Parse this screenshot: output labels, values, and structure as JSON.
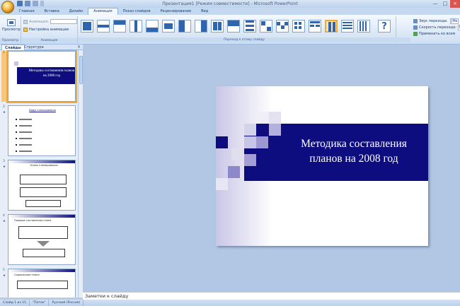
{
  "window": {
    "title": "Презентация1 [Режим совместимости] - Microsoft PowerPoint",
    "controls": [
      "—",
      "□",
      "×"
    ]
  },
  "tabs": [
    "Главная",
    "Вставка",
    "Дизайн",
    "Анимация",
    "Показ слайдов",
    "Рецензирование",
    "Вид"
  ],
  "active_tab": "Анимация",
  "ribbon": {
    "preview_label": "Просмотр",
    "preview_group": "Просмотр",
    "animation_label": "Анимация:",
    "animation_dropdown": "",
    "custom_animation": "Настройка анимации",
    "animations_group": "Анимация",
    "transitions_group": "Переход к этому слайду",
    "sound_label": "Звук перехода:",
    "speed_label": "Скорость перехода:",
    "apply_all_label": "Применить ко всем",
    "sound_value": "[Не",
    "speed_value": "Бы"
  },
  "panel": {
    "tab_slides": "Слайды",
    "tab_outline": "Структура",
    "close": "×"
  },
  "thumbnails": [
    {
      "num": "1",
      "title": "Методика составления планов на 2008 год"
    },
    {
      "num": "2",
      "title": "Виды планирования"
    },
    {
      "num": "3",
      "title": "Этапы планирования"
    },
    {
      "num": "4",
      "title": "Порядок составления плана"
    },
    {
      "num": "5",
      "title": "Содержание плана"
    }
  ],
  "slide": {
    "title_line1": "Методика составления",
    "title_line2": "планов на 2008 год"
  },
  "notes_placeholder": "Заметки к слайду",
  "status": {
    "slide_info": "Слайд 1 из 15",
    "theme": "\"Поток\"",
    "language": "Русский (Россия)"
  },
  "colors": {
    "slide_band": "#0d0d80",
    "accent_selection": "#f2a93b"
  }
}
